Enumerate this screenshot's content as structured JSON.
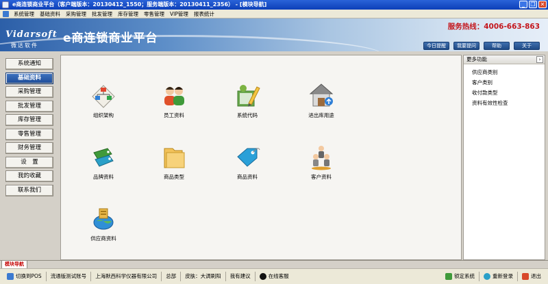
{
  "window": {
    "title": "e商连锁商业平台（客户端版本：20130412_1550；服务端版本：20130411_2356） - [模块导航]",
    "controls": [
      "minimize",
      "restore",
      "close"
    ]
  },
  "menu": [
    "系统管理",
    "基础资料",
    "采购管理",
    "批发管理",
    "库存管理",
    "零售管理",
    "VIP管理",
    "报表统计"
  ],
  "banner": {
    "logo_text": "Vidarsoft",
    "logo_sub": "微达软件",
    "title": "e商连锁商业平台",
    "hotline": "服务热线：4006-663-863",
    "buttons": [
      "今日提醒",
      "我要提问",
      "帮助",
      "关于"
    ]
  },
  "nav": {
    "active_index": 1,
    "items": [
      "系统通知",
      "基础资料",
      "采购管理",
      "批发管理",
      "库存管理",
      "零售管理",
      "财务管理",
      "设　置",
      "我的收藏",
      "联系我们"
    ]
  },
  "modules": [
    {
      "label": "组织架构",
      "icon": "org-chart-icon"
    },
    {
      "label": "员工资料",
      "icon": "employees-icon"
    },
    {
      "label": "系统代码",
      "icon": "system-code-icon"
    },
    {
      "label": "进出库用途",
      "icon": "warehouse-icon"
    },
    {
      "label": "品牌资料",
      "icon": "brand-tags-icon"
    },
    {
      "label": "商品类型",
      "icon": "folder-icon"
    },
    {
      "label": "商品资料",
      "icon": "price-tag-icon"
    },
    {
      "label": "客户资料",
      "icon": "customers-icon"
    },
    {
      "label": "供应商资料",
      "icon": "supplier-globe-icon"
    }
  ],
  "more": {
    "title": "更多功能",
    "items": [
      "供应商类别",
      "客户类别",
      "收付款类型",
      "资料有效性检查"
    ]
  },
  "tab": {
    "label": "模块导航"
  },
  "status": {
    "left": [
      "切换到POS",
      "流通版测试账号",
      "上海默西科学仪器有限公司",
      "总部",
      "皮肤：大调刷阳",
      "我有建议",
      "在线客服"
    ],
    "right": [
      "锁定系统",
      "重新登录",
      "退出"
    ]
  },
  "colors": {
    "title_bar": "#0c3fb8",
    "accent": "#1d4c98",
    "hotline": "#c4161c",
    "tab_text": "#c40000"
  }
}
